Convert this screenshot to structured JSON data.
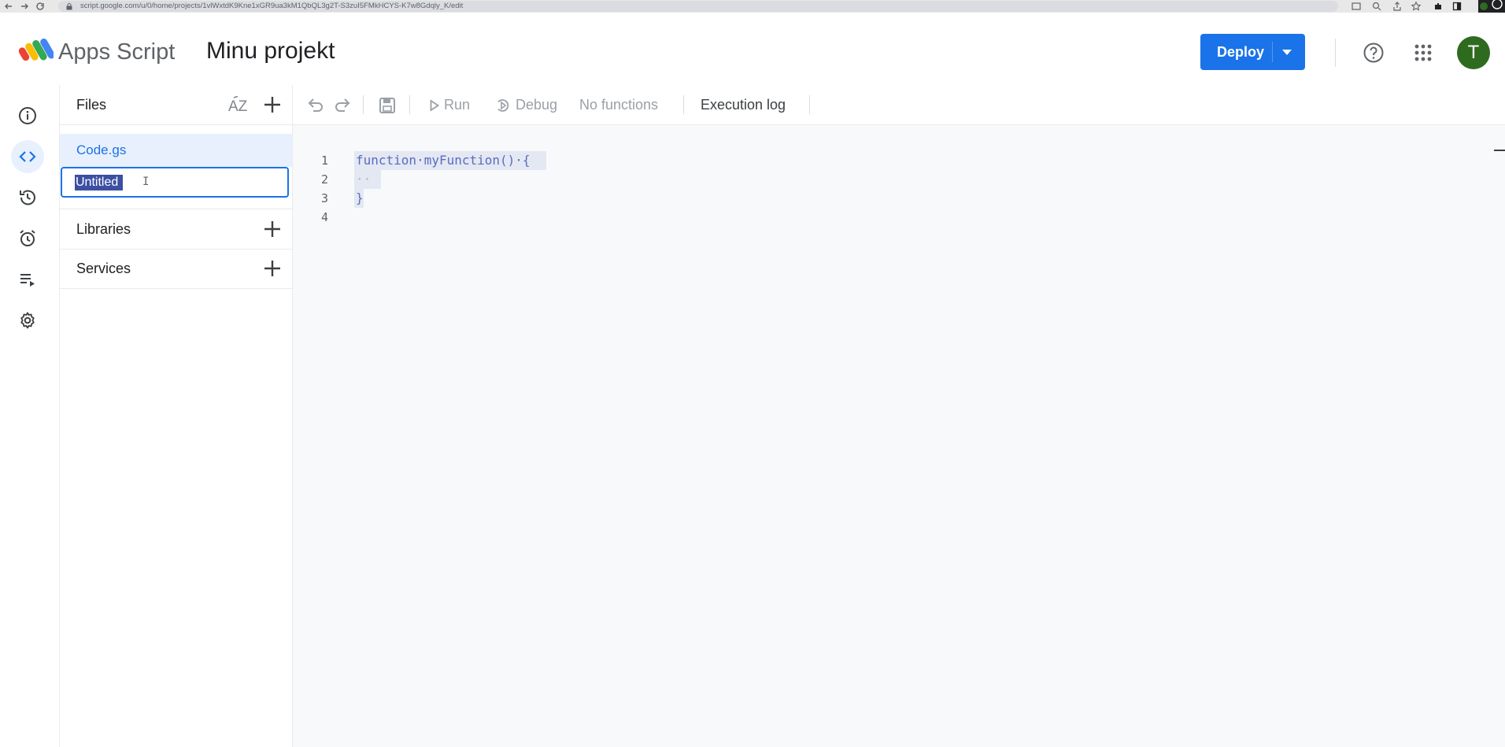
{
  "browser": {
    "url": "script.google.com/u/0/home/projects/1vlWxtdK9Kne1xGR9ua3kM1QbQL3g2T-S3zuI5FMkHCYS-K7w8Gdqly_K/edit"
  },
  "header": {
    "app_name": "Apps Script",
    "project_title": "Minu projekt",
    "deploy_label": "Deploy",
    "avatar_initial": "T",
    "accent_color": "#1a73e8"
  },
  "rail": {
    "items": [
      {
        "name": "overview",
        "icon": "info-icon"
      },
      {
        "name": "editor",
        "icon": "code-icon",
        "active": true
      },
      {
        "name": "triggers-history",
        "icon": "history-icon"
      },
      {
        "name": "triggers",
        "icon": "alarm-icon"
      },
      {
        "name": "executions",
        "icon": "executions-icon"
      },
      {
        "name": "settings",
        "icon": "gear-icon"
      }
    ]
  },
  "files_panel": {
    "title": "Files",
    "files": [
      {
        "name": "Code.gs",
        "selected": true
      }
    ],
    "rename_value": "Untitled",
    "libraries_label": "Libraries",
    "services_label": "Services"
  },
  "toolbar": {
    "run_label": "Run",
    "debug_label": "Debug",
    "function_select_label": "No functions",
    "execution_log_label": "Execution log"
  },
  "editor": {
    "lines": [
      {
        "number": "1",
        "text": "function·myFunction()·{"
      },
      {
        "number": "2",
        "text": "··"
      },
      {
        "number": "3",
        "text": "}"
      },
      {
        "number": "4",
        "text": ""
      }
    ]
  }
}
